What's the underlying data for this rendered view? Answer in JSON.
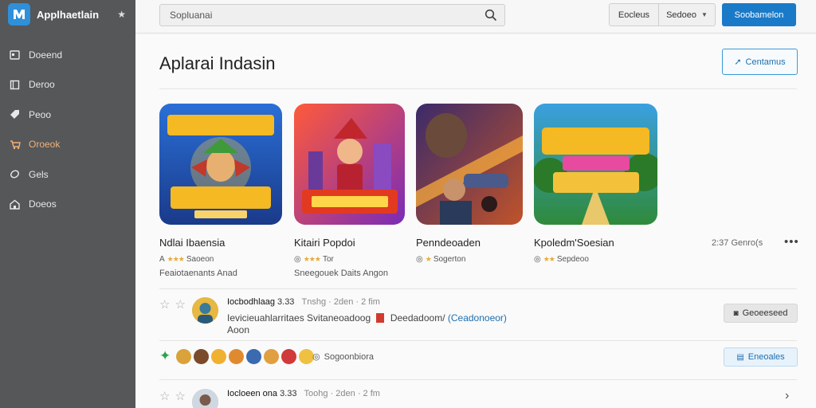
{
  "sidebar": {
    "app_name": "Applhaetlain",
    "pin_icon": "star-icon",
    "items": [
      {
        "label": "Doeend",
        "icon": "calendar-icon",
        "active": false
      },
      {
        "label": "Deroo",
        "icon": "book-icon",
        "active": false
      },
      {
        "label": "Peoo",
        "icon": "tag-icon",
        "active": false
      },
      {
        "label": "Oroeok",
        "icon": "cart-icon",
        "active": true
      },
      {
        "label": "Gels",
        "icon": "leaf-icon",
        "active": false
      },
      {
        "label": "Doeos",
        "icon": "home-icon",
        "active": false
      }
    ]
  },
  "topbar": {
    "search_value": "Sopluanai",
    "seg_left": "Eocleus",
    "seg_right": "Sedoeo",
    "primary_label": "Soobamelon"
  },
  "main": {
    "title": "Aplarai Indasin",
    "outline_button": "Centamus",
    "apps": [
      {
        "title": "Ndlai Ibaensia",
        "rating": "Saoeon",
        "subtitle": "Feaiotaenants Anad",
        "art": "game-art-hero"
      },
      {
        "title": "Kitairi Popdoi",
        "rating": "Tor",
        "subtitle": "Sneegouek Daits Angon",
        "art": "game-art-pirate"
      },
      {
        "title": "Penndeoaden",
        "rating": "Sogerton",
        "subtitle": "",
        "art": "game-art-shooter"
      },
      {
        "title": "Kpoledm'Soesian",
        "rating": "Sepdeoo",
        "subtitle": "",
        "art": "game-art-castle"
      }
    ],
    "apps_meta": "2:37 Genro(s",
    "reviews": [
      {
        "name": "Iocbodhlaag",
        "score": "3.33",
        "time": "Tnshg · 2den · 2 fim",
        "text": "Ievicieuahlarritaes Svitaneoadoog",
        "tag_text": "Deedadoom/",
        "link": "(Ceadonoeor)",
        "line2": "Aoon",
        "button": "Geoeeseed"
      },
      {
        "name": "Iocloeen ona",
        "score": "3.33",
        "time": "Toohg · 2den · 2 fm",
        "text": "",
        "tag_text": "",
        "link": "",
        "line2": "",
        "button": ""
      }
    ],
    "reactions_label": "Sogoonbiora",
    "reactions_button": "Eneoales"
  },
  "colors": {
    "sidebar_bg": "#555759",
    "accent": "#1a7ac8",
    "active_nav": "#f0b07a"
  }
}
